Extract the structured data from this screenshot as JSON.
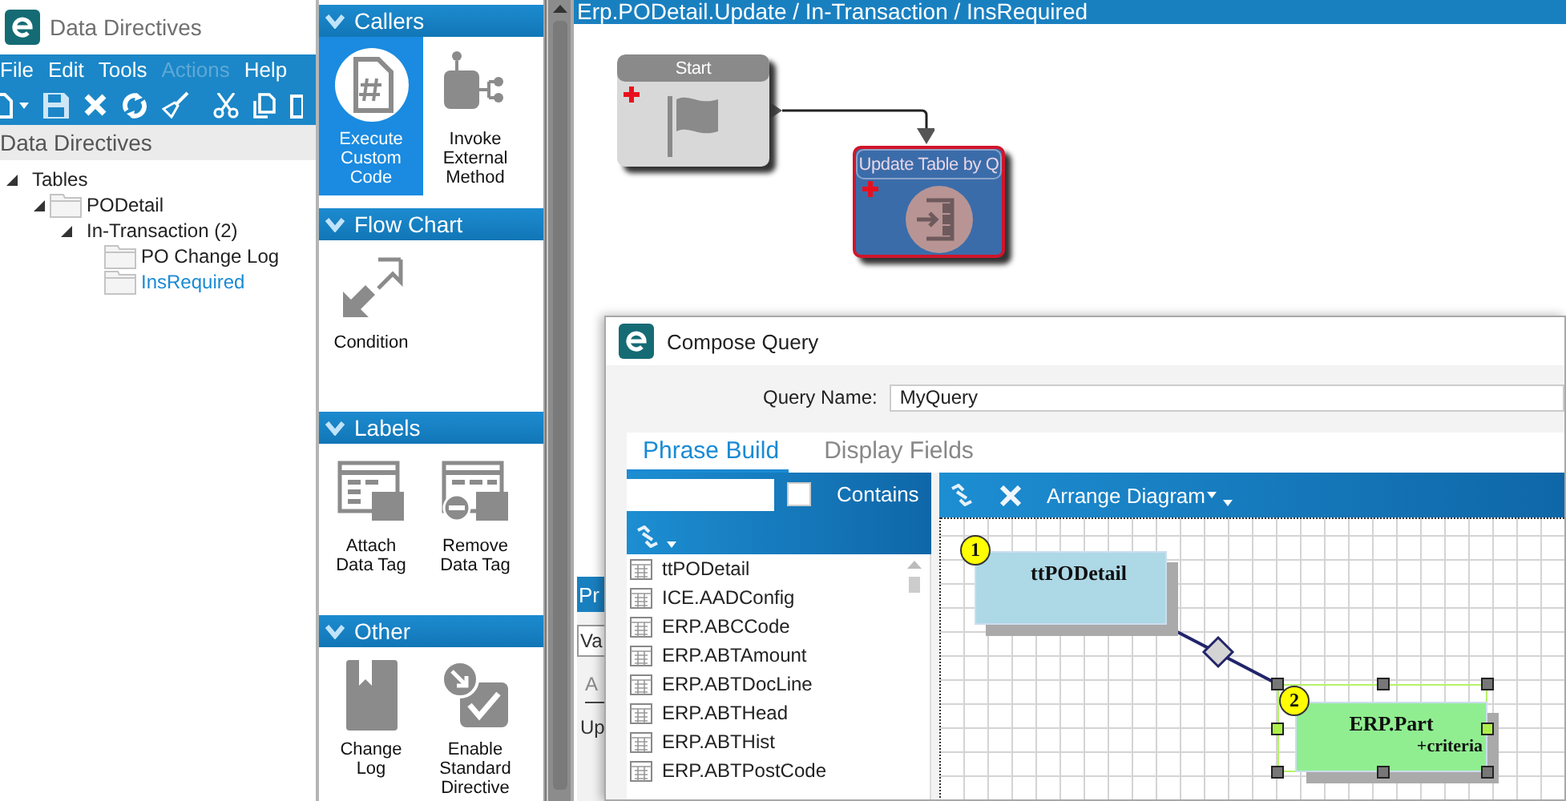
{
  "app_window": {
    "title": "Data Directives",
    "menu": [
      {
        "label": "File",
        "disabled": false
      },
      {
        "label": "Edit",
        "disabled": false
      },
      {
        "label": "Tools",
        "disabled": false
      },
      {
        "label": "Actions",
        "disabled": true
      },
      {
        "label": "Help",
        "disabled": false
      }
    ],
    "panel_title": "Data Directives",
    "tree": [
      {
        "label": "Tables",
        "kind": "group",
        "expanded": true,
        "selected": false,
        "children": [
          {
            "label": "PODetail",
            "kind": "folder",
            "expanded": true,
            "selected": false,
            "children": [
              {
                "label": "In-Transaction (2)",
                "kind": "group",
                "expanded": true,
                "selected": false,
                "children": [
                  {
                    "label": "PO Change Log",
                    "kind": "folder",
                    "selected": false
                  },
                  {
                    "label": "InsRequired",
                    "kind": "folder",
                    "selected": true
                  }
                ]
              }
            ]
          }
        ]
      }
    ]
  },
  "toolbox": {
    "sections": [
      {
        "title": "Callers",
        "expanded": true,
        "items": [
          {
            "label": "Execute Custom Code",
            "kind": "code",
            "selected": true
          },
          {
            "label": "Invoke External Method",
            "kind": "method",
            "selected": false
          }
        ]
      },
      {
        "title": "Flow Chart",
        "expanded": true,
        "items": [
          {
            "label": "Condition",
            "kind": "condition",
            "selected": false
          }
        ]
      },
      {
        "title": "Labels",
        "expanded": true,
        "items": [
          {
            "label": "Attach Data Tag",
            "kind": "attach-tag",
            "selected": false
          },
          {
            "label": "Remove Data Tag",
            "kind": "remove-tag",
            "selected": false
          }
        ]
      },
      {
        "title": "Other",
        "expanded": true,
        "items": [
          {
            "label": "Change Log",
            "kind": "change-log",
            "selected": false
          },
          {
            "label": "Enable Standard Directive",
            "kind": "enable-directive",
            "selected": false
          }
        ]
      }
    ]
  },
  "designer": {
    "breadcrumb": "Erp.PODetail.Update / In-Transaction / InsRequired",
    "nodes": [
      {
        "title": "Start",
        "kind": "start",
        "selected": false
      },
      {
        "title": "Update Table by Q",
        "kind": "update",
        "selected": true
      }
    ]
  },
  "properties_panel": {
    "title": "Pr",
    "tab": "Va",
    "column": "A",
    "value": "Up"
  },
  "compose_query": {
    "title": "Compose Query",
    "query_name_label": "Query Name:",
    "query_name": "MyQuery",
    "tabs": [
      {
        "label": "Phrase Build",
        "selected": true
      },
      {
        "label": "Display Fields",
        "selected": false
      }
    ],
    "contains": {
      "label": "Contains",
      "checked": false
    },
    "tables": [
      "ttPODetail",
      "ICE.AADConfig",
      "ERP.ABCCode",
      "ERP.ABTAmount",
      "ERP.ABTDocLine",
      "ERP.ABTHead",
      "ERP.ABTHist",
      "ERP.ABTPostCode"
    ],
    "arrange_label": "Arrange Diagram",
    "diagram": [
      {
        "number": "1",
        "name": "ttPODetail",
        "color": "#add8e6",
        "selected": false
      },
      {
        "number": "2",
        "name": "ERP.Part",
        "criteria": "+criteria",
        "color": "#90ee90",
        "selected": true
      }
    ]
  }
}
